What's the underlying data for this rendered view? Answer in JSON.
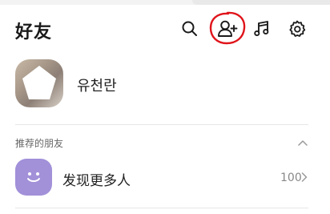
{
  "header": {
    "title": "好友",
    "icons": [
      "search-icon",
      "add-friend-icon",
      "music-icon",
      "gear-icon"
    ]
  },
  "profile": {
    "name": "유천란"
  },
  "recommended": {
    "section_title": "推荐的朋友",
    "discover_label": "发现更多人",
    "count": "100"
  },
  "colors": {
    "accent_purple": "#a290d9",
    "annotation_red": "#e0141b",
    "divider": "#e6e6e6"
  }
}
